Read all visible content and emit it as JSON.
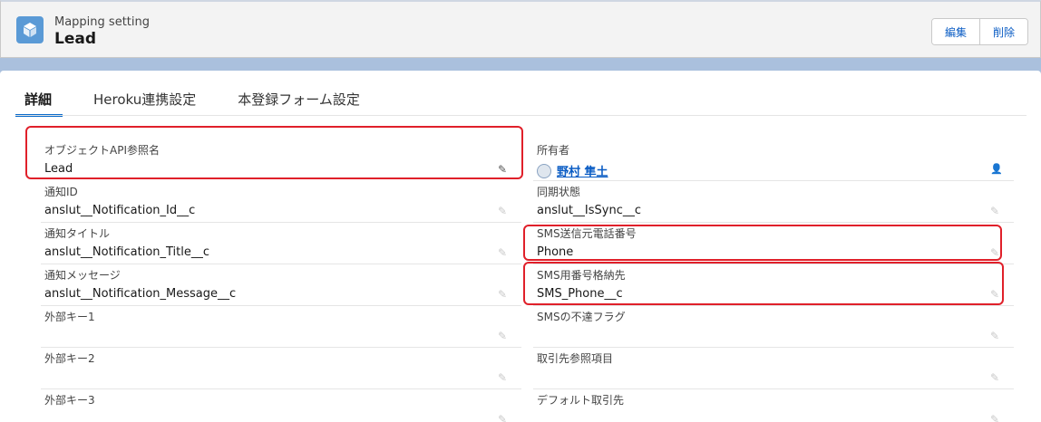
{
  "header": {
    "subtitle": "Mapping setting",
    "title": "Lead",
    "icon": "cube-icon",
    "buttons": {
      "edit": "編集",
      "delete": "削除"
    }
  },
  "tabs": [
    {
      "label": "詳細",
      "active": true
    },
    {
      "label": "Heroku連携設定",
      "active": false
    },
    {
      "label": "本登録フォーム設定",
      "active": false
    }
  ],
  "left_fields": [
    {
      "label": "オブジェクトAPI参照名",
      "value": "Lead"
    },
    {
      "label": "通知ID",
      "value": "anslut__Notification_Id__c"
    },
    {
      "label": "通知タイトル",
      "value": "anslut__Notification_Title__c"
    },
    {
      "label": "通知メッセージ",
      "value": "anslut__Notification_Message__c"
    },
    {
      "label": "外部キー1",
      "value": ""
    },
    {
      "label": "外部キー2",
      "value": ""
    },
    {
      "label": "外部キー3",
      "value": ""
    }
  ],
  "right_fields": [
    {
      "label": "所有者",
      "value": "野村 隼土"
    },
    {
      "label": "同期状態",
      "value": "anslut__IsSync__c"
    },
    {
      "label": "SMS送信元電話番号",
      "value": "Phone"
    },
    {
      "label": "SMS用番号格納先",
      "value": "SMS_Phone__c"
    },
    {
      "label": "SMSの不達フラグ",
      "value": ""
    },
    {
      "label": "取引先参照項目",
      "value": ""
    },
    {
      "label": "デフォルト取引先",
      "value": ""
    }
  ],
  "colors": {
    "accent": "#0b6bcb",
    "link": "#0a5cc4",
    "highlight": "#e0202a"
  }
}
